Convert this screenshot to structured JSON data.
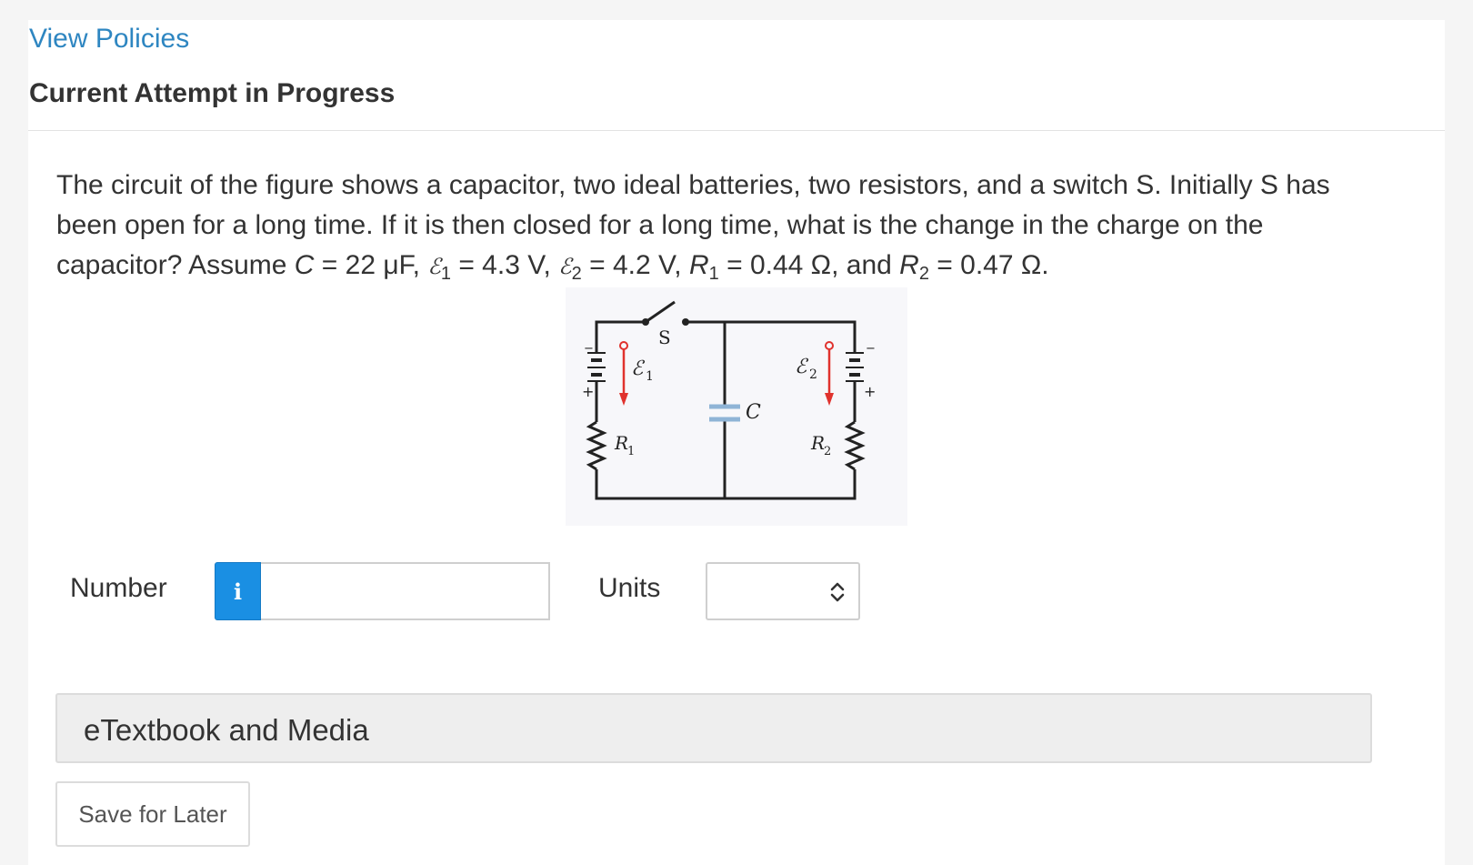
{
  "header": {
    "view_policies": "View Policies",
    "attempt_title": "Current Attempt in Progress"
  },
  "question": {
    "line1": "The circuit of the figure shows a capacitor, two ideal batteries, two resistors, and a switch S. Initially S has",
    "line2": "been open for a long time. If it is then closed for a long time, what is the change in the charge on the",
    "part_a": "capacitor? Assume ",
    "c_symbol": "C",
    "c_value": " = 22 μF, ",
    "e_symbol": "ℰ",
    "e1_sub": "1",
    "e1_value": " = 4.3 V, ",
    "e2_sub": "2",
    "e2_value": " = 4.2 V, ",
    "r_symbol": "R",
    "r1_sub": "1",
    "r1_value": " = 0.44 Ω, and ",
    "r2_sub": "2",
    "r2_value": " = 0.47 Ω."
  },
  "figure": {
    "switch_label": "S",
    "e1_label": "ℰ",
    "e1_sub": "1",
    "e2_label": "ℰ",
    "e2_sub": "2",
    "c_label": "C",
    "r1_label": "R",
    "r1_sub": "1",
    "r2_label": "R",
    "r2_sub": "2",
    "plus": "+",
    "minus": "−",
    "wire_color": "#222222",
    "arrow_color": "#e0322d",
    "capacitor_color": "#8fb4d6"
  },
  "answer": {
    "number_label": "Number",
    "info_icon": "i",
    "number_value": "",
    "units_label": "Units",
    "units_selected": ""
  },
  "etextbook": {
    "label": "eTextbook and Media"
  },
  "actions": {
    "save_label": "Save for Later"
  },
  "colors": {
    "link": "#2e86c1",
    "info_button": "#1a8fe3",
    "text": "#333333"
  }
}
